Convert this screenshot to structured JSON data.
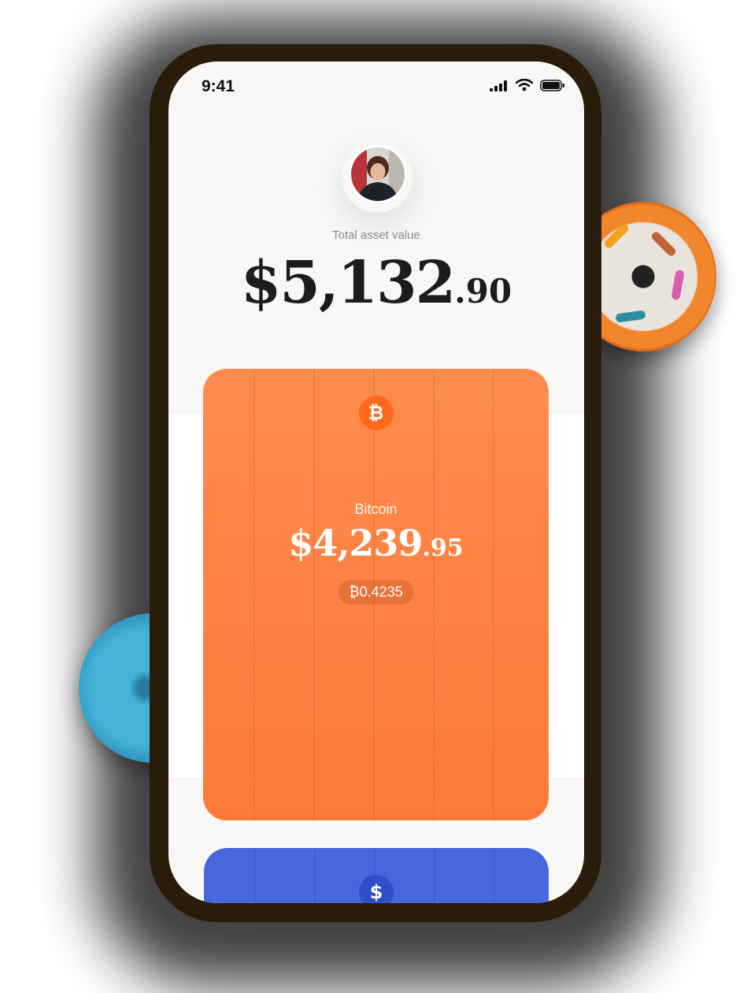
{
  "status_bar": {
    "time": "9:41"
  },
  "profile": {
    "avatar": "user-avatar"
  },
  "summary": {
    "label": "Total asset value",
    "amount_main": "$5,132",
    "amount_cents": ".90"
  },
  "cards": [
    {
      "icon": "bitcoin-icon",
      "symbol": "₿",
      "name": "Bitcoin",
      "amount_main": "$4,239",
      "amount_cents": ".95",
      "holding": "₿0.4235",
      "color": "#ff7f3f"
    },
    {
      "icon": "dollar-icon",
      "symbol": "$",
      "color": "#4767dc"
    }
  ],
  "colors": {
    "bitcoin_orange": "#ff7f3f",
    "usd_blue": "#4767dc",
    "phone_frame": "#2a1c0b"
  }
}
